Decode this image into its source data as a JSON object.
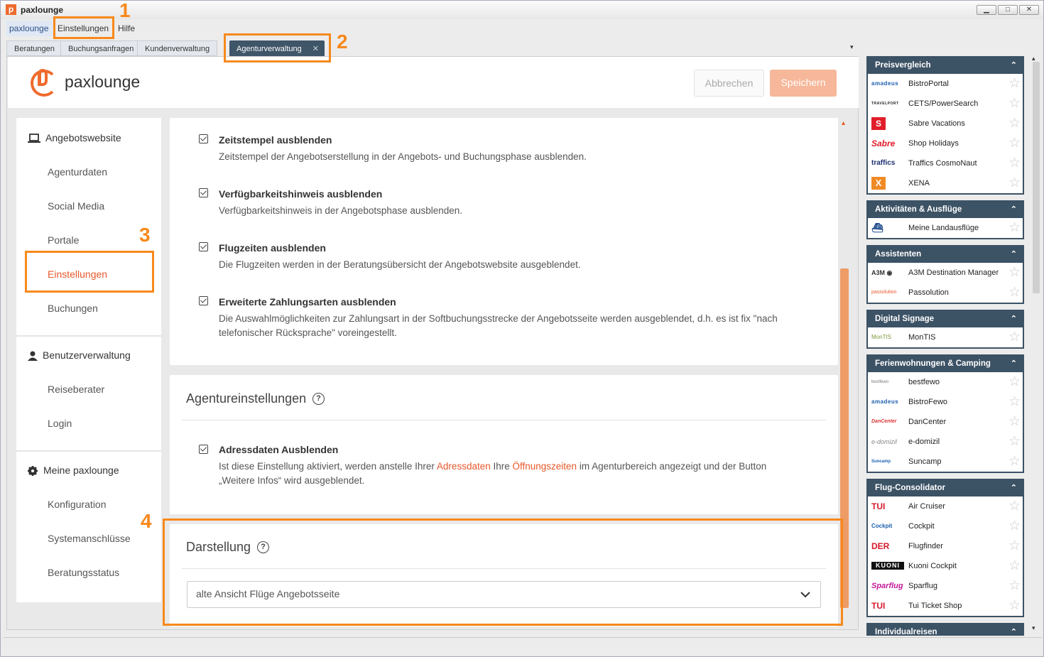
{
  "window": {
    "title": "paxlounge",
    "minimize": "▁",
    "maximize": "□",
    "close": "✕"
  },
  "menu": [
    "paxlounge",
    "Einstellungen",
    "Hilfe"
  ],
  "tabs": [
    "Beratungen",
    "Buchungsanfragen",
    "Kundenverwaltung"
  ],
  "active_tab": {
    "label": "Agenturverwaltung",
    "close": "✕"
  },
  "annotations": [
    "1",
    "2",
    "3",
    "4"
  ],
  "header": {
    "brand": "paxlounge",
    "cancel": "Abbrechen",
    "save": "Speichern"
  },
  "nav": {
    "sections": [
      {
        "title": "Angebotswebsite",
        "icon": "laptop-icon",
        "items": [
          "Agenturdaten",
          "Social Media",
          "Portale",
          "Einstellungen",
          "Buchungen"
        ]
      },
      {
        "title": "Benutzerverwaltung",
        "icon": "user-icon",
        "items": [
          "Reiseberater",
          "Login"
        ]
      },
      {
        "title": "Meine paxlounge",
        "icon": "gear-icon",
        "items": [
          "Konfiguration",
          "Systemanschlüsse",
          "Beratungsstatus"
        ]
      }
    ]
  },
  "options": [
    {
      "title": "Zeitstempel ausblenden",
      "desc": "Zeitstempel der Angebotserstellung in der Angebots- und Buchungsphase ausblenden."
    },
    {
      "title": "Verfügbarkeitshinweis ausblenden",
      "desc": "Verfügbarkeitshinweis in der Angebotsphase ausblenden."
    },
    {
      "title": "Flugzeiten ausblenden",
      "desc": "Die Flugzeiten werden in der Beratungsübersicht der Angebotswebsite ausgeblendet."
    },
    {
      "title": "Erweiterte Zahlungsarten ausblenden",
      "desc1": "Die Auswahlmöglichkeiten zur Zahlungsart in der Softbuchungsstrecke der Angebotsseite werden ausgeblendet, d.h. es ist fix \"nach",
      "desc2": "telefonischer Rücksprache\" voreingestellt."
    }
  ],
  "agency": {
    "title": "Agentureinstellungen",
    "option_title": "Adressdaten Ausblenden",
    "desc_a": "Ist diese Einstellung aktiviert, werden anstelle Ihrer ",
    "link1": "Adressdaten",
    "desc_b": " Ihre ",
    "link2": "Öffnungszeiten",
    "desc_c": " im Agenturbereich angezeigt und der Button",
    "desc2": "„Weitere Infos“ wird ausgeblendet."
  },
  "display": {
    "title": "Darstellung",
    "select_value": "alte Ansicht Flüge Angebotsseite"
  },
  "right_panel": [
    {
      "title": "Preisvergleich",
      "items": [
        {
          "logo": "amadeus",
          "label": "BistroPortal"
        },
        {
          "logo": "TRAVELPORT",
          "label": "CETS/PowerSearch"
        },
        {
          "logo": "S",
          "label": "Sabre Vacations"
        },
        {
          "logo": "Sabre",
          "label": "Shop Holidays"
        },
        {
          "logo": "traffics",
          "label": "Traffics CosmoNaut"
        },
        {
          "logo": "X",
          "label": "XENA"
        }
      ]
    },
    {
      "title": "Aktivitäten & Ausflüge",
      "items": [
        {
          "logo": "ship",
          "label": "Meine Landausflüge"
        }
      ]
    },
    {
      "title": "Assistenten",
      "items": [
        {
          "logo": "A3M",
          "label": "A3M Destination Manager"
        },
        {
          "logo": "passolution",
          "label": "Passolution"
        }
      ]
    },
    {
      "title": "Digital Signage",
      "items": [
        {
          "logo": "MonTIS",
          "label": "MonTIS"
        }
      ]
    },
    {
      "title": "Ferienwohnungen & Camping",
      "items": [
        {
          "logo": "bestfewo",
          "label": "bestfewo"
        },
        {
          "logo": "amadeus",
          "label": "BistroFewo"
        },
        {
          "logo": "DanCenter",
          "label": "DanCenter"
        },
        {
          "logo": "e-domizil",
          "label": "e-domizil"
        },
        {
          "logo": "Suncamp",
          "label": "Suncamp"
        }
      ]
    },
    {
      "title": "Flug-Consolidator",
      "items": [
        {
          "logo": "TUI",
          "label": "Air Cruiser"
        },
        {
          "logo": "Cockpit",
          "label": "Cockpit"
        },
        {
          "logo": "DER",
          "label": "Flugfinder"
        },
        {
          "logo": "KUONI",
          "label": "Kuoni Cockpit"
        },
        {
          "logo": "Sparflug",
          "label": "Sparflug"
        },
        {
          "logo": "TUI",
          "label": "Tui Ticket Shop"
        }
      ]
    },
    {
      "title": "Individualreisen",
      "items": []
    }
  ],
  "colors": {
    "accent": "#ef6a2d",
    "annotation": "#f7891c",
    "panel_header": "#3c5265"
  }
}
